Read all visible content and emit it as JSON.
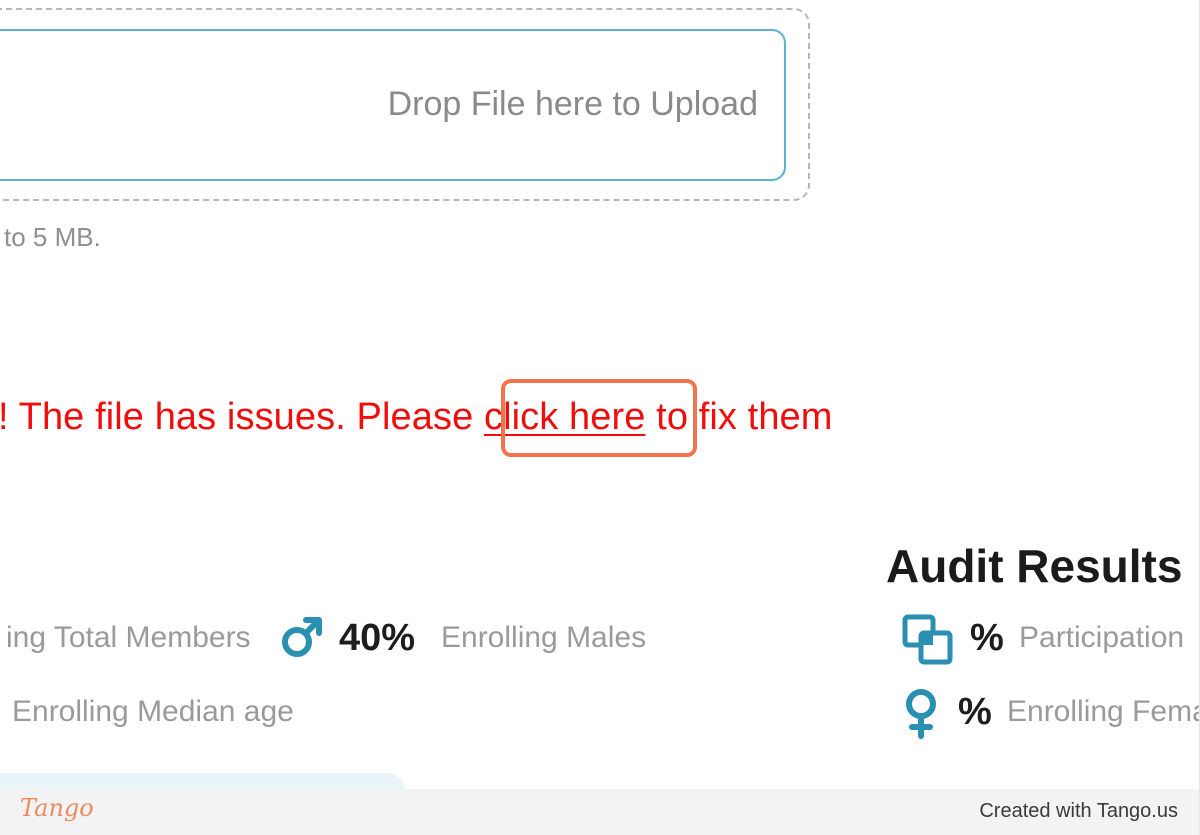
{
  "upload": {
    "drop_text": "Drop File here to Upload",
    "size_hint": "to 5 MB."
  },
  "error": {
    "prefix": "! The file has issues. Please ",
    "link_text": "click here",
    "suffix": " to fix them",
    "color": "#f20d0d"
  },
  "highlight": {
    "color": "#f2744a"
  },
  "stats": {
    "total_members_label": "ing Total Members",
    "males_value": "40%",
    "males_label": "Enrolling Males",
    "median_age_label": "Enrolling Median age"
  },
  "audit": {
    "title": "Audit Results",
    "participation_value": "%",
    "participation_label": "Participation",
    "females_value": "%",
    "females_label": "Enrolling Fema"
  },
  "icons": {
    "male": "male-symbol-icon",
    "participation": "overlapping-squares-icon",
    "female": "female-symbol-icon",
    "accent_color": "#2a8fb0"
  },
  "footer": {
    "logo": "Tango",
    "created_with": "Created with Tango.us"
  }
}
